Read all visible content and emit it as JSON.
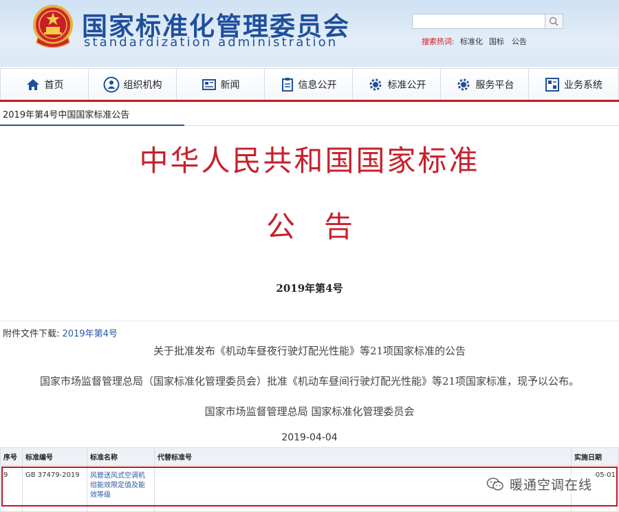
{
  "header": {
    "title": "国家标准化管理委员会",
    "subtitle": "standardization administration",
    "search": {
      "placeholder": ""
    },
    "hot_label": "搜索热词:",
    "hot_items": [
      "标准化",
      "国标",
      "公告"
    ]
  },
  "nav": {
    "items": [
      {
        "label": "首页",
        "icon": "home-icon"
      },
      {
        "label": "组织机构",
        "icon": "org-icon"
      },
      {
        "label": "新闻",
        "icon": "news-icon"
      },
      {
        "label": "信息公开",
        "icon": "clipboard-icon"
      },
      {
        "label": "标准公开",
        "icon": "gear-icon"
      },
      {
        "label": "服务平台",
        "icon": "gear-icon"
      },
      {
        "label": "业务系统",
        "icon": "system-icon"
      }
    ]
  },
  "breadcrumb": "2019年第4号中国国家标准公告",
  "document": {
    "title": "中华人民共和国国家标准",
    "subtitle": "公告",
    "number": "2019年第4号"
  },
  "attachment": {
    "label": "附件文件下载:",
    "link": "2019年第4号"
  },
  "body": {
    "line1": "关于批准发布《机动车昼夜行驶灯配光性能》等21项国家标准的公告",
    "line2": "国家市场监督管理总局（国家标准化管理委员会）批准《机动车昼间行驶灯配光性能》等21项国家标准，现予以公布。",
    "signer": "国家市场监督管理总局 国家标准化管理委员会",
    "date": "2019-04-04"
  },
  "table": {
    "headers": [
      "序号",
      "标准编号",
      "标准名称",
      "代替标准号",
      "实施日期"
    ],
    "rows": [
      {
        "no": "9",
        "code": "GB 37479-2019",
        "name": "风管送风式空调机组能效限定值及能效等级",
        "replace": "",
        "date": "-05-01"
      }
    ]
  },
  "watermark": "暖通空调在线",
  "colors": {
    "brand_blue": "#1f4f9c",
    "accent_red": "#c6161e",
    "title_red": "#c7202c",
    "link_blue": "#2a58a6"
  }
}
